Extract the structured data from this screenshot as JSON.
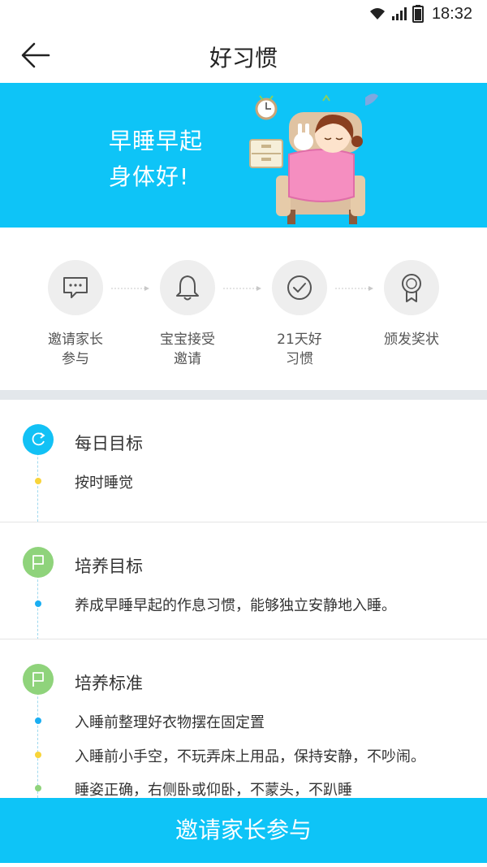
{
  "status_bar": {
    "time": "18:32"
  },
  "nav": {
    "title": "好习惯"
  },
  "banner": {
    "line1": "早睡早起",
    "line2": "身体好!"
  },
  "steps": [
    {
      "line1": "邀请家长",
      "line2": "参与",
      "icon": "chat-icon"
    },
    {
      "line1": "宝宝接受",
      "line2": "邀请",
      "icon": "bell-icon"
    },
    {
      "line1": "21天好",
      "line2": "习惯",
      "icon": "check-icon"
    },
    {
      "line1": "颁发奖状",
      "line2": "",
      "icon": "award-icon"
    }
  ],
  "daily_goal": {
    "title": "每日目标",
    "items": [
      "按时睡觉"
    ]
  },
  "cultivate_goal": {
    "title": "培养目标",
    "items": [
      "养成早睡早起的作息习惯，能够独立安静地入睡。"
    ]
  },
  "cultivate_standard": {
    "title": "培养标准",
    "items": [
      "入睡前整理好衣物摆在固定置",
      "入睡前小手空，不玩弄床上用品，保持安静，不吵闹。",
      "睡姿正确，右侧卧或仰卧，不蒙头，不趴睡"
    ]
  },
  "bottom_button": {
    "label": "邀请家长参与"
  },
  "colors": {
    "accent": "#0ec4f7",
    "green": "#8fd37b",
    "yellow": "#f8d43a"
  }
}
